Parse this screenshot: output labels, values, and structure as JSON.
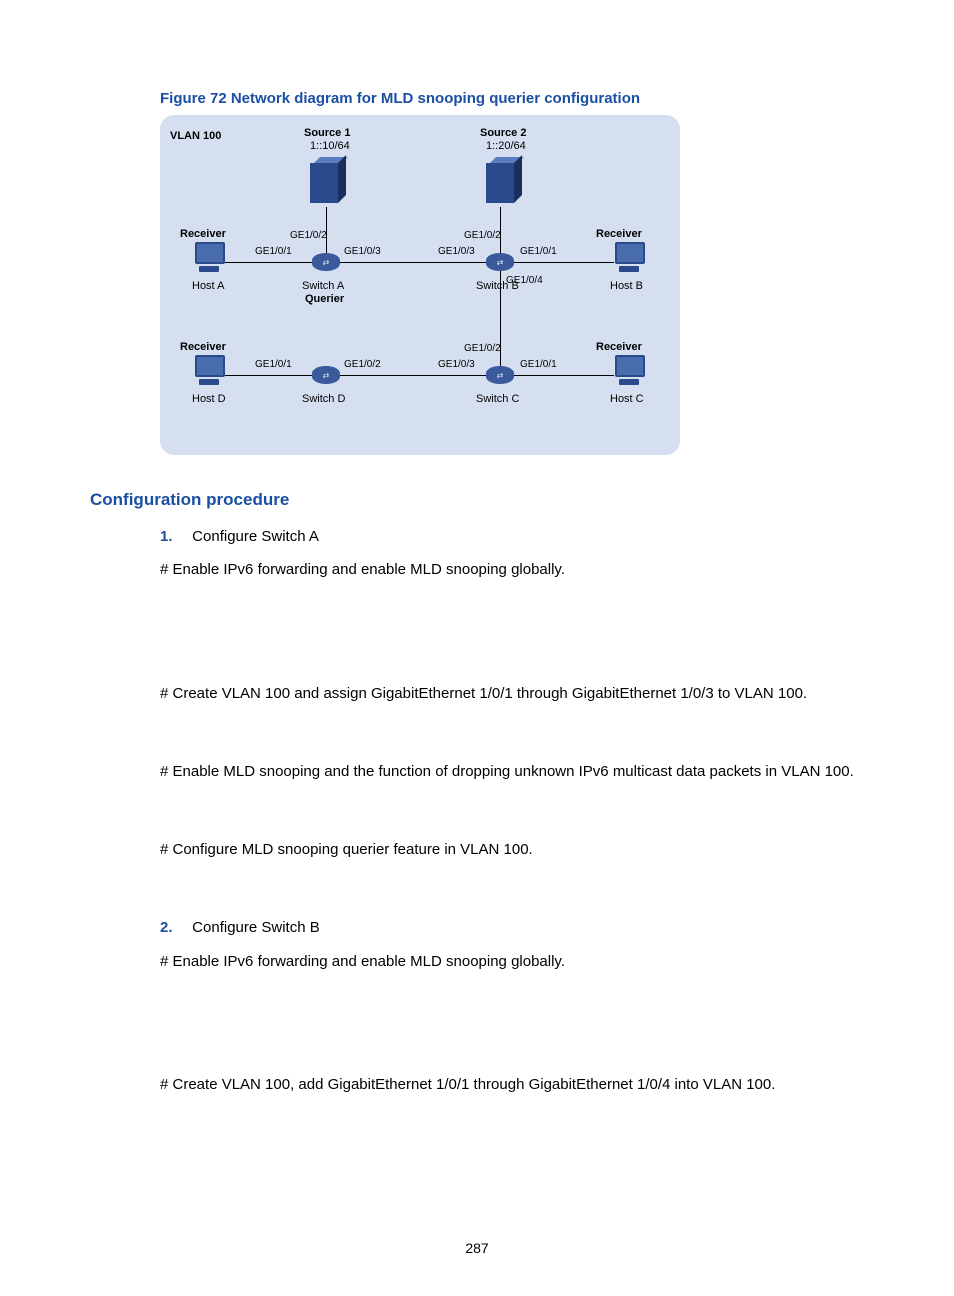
{
  "figure": {
    "caption": "Figure 72 Network diagram for MLD snooping querier configuration",
    "vlan_label": "VLAN 100",
    "source1": {
      "title": "Source 1",
      "addr": "1::10/64"
    },
    "source2": {
      "title": "Source 2",
      "addr": "1::20/64"
    },
    "receiver_label": "Receiver",
    "hosts": {
      "a": "Host A",
      "b": "Host B",
      "c": "Host C",
      "d": "Host D"
    },
    "switches": {
      "a": "Switch A",
      "b": "Switch B",
      "c": "Switch C",
      "d": "Switch D",
      "querier": "Querier"
    },
    "ports": {
      "ge101": "GE1/0/1",
      "ge102": "GE1/0/2",
      "ge103": "GE1/0/3",
      "ge104": "GE1/0/4"
    }
  },
  "heading": "Configuration procedure",
  "steps": {
    "s1_num": "1.",
    "s1_title": "Configure Switch A",
    "s1_p1": "# Enable IPv6 forwarding and enable MLD snooping globally.",
    "s1_p2": "# Create VLAN 100 and assign GigabitEthernet 1/0/1 through GigabitEthernet 1/0/3 to VLAN 100.",
    "s1_p3": "# Enable MLD snooping and the function of dropping unknown IPv6 multicast data packets in VLAN 100.",
    "s1_p4": "# Configure MLD snooping querier feature in VLAN 100.",
    "s2_num": "2.",
    "s2_title": "Configure Switch B",
    "s2_p1": "# Enable IPv6 forwarding and enable MLD snooping globally.",
    "s2_p2": "# Create VLAN 100, add GigabitEthernet 1/0/1 through GigabitEthernet 1/0/4 into VLAN 100."
  },
  "page_number": "287"
}
